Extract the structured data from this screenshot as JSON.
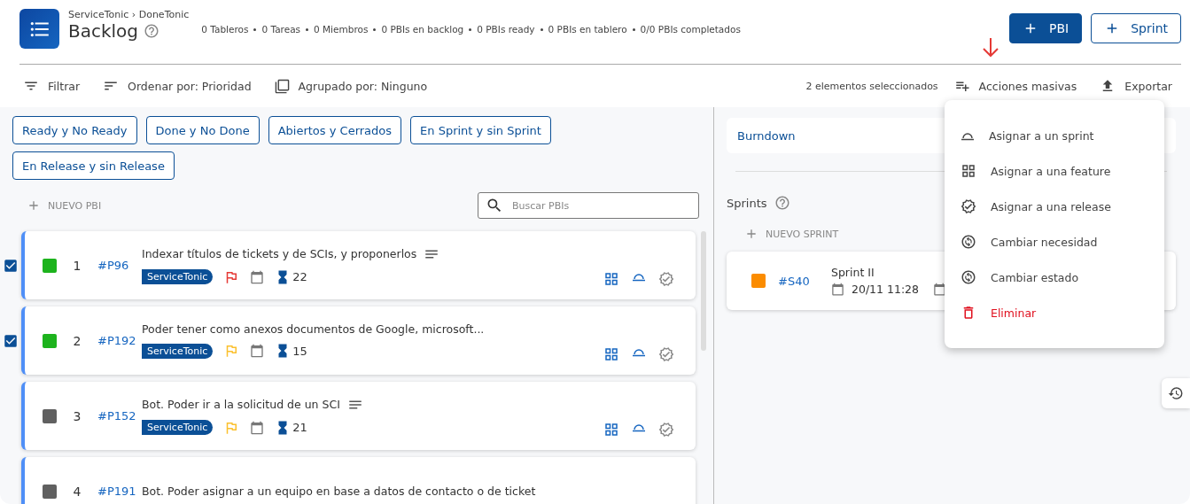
{
  "header": {
    "breadcrumb": "ServiceTonic › DoneTonic",
    "title": "Backlog",
    "stats": [
      "0 Tableros",
      "0 Tareas",
      "0 Miembros",
      "0 PBIs en backlog",
      "0 PBIs ready",
      "0 PBIs en tablero",
      "0/0 PBIs completados"
    ],
    "buttons": [
      {
        "label": "PBI",
        "kind": "primary"
      },
      {
        "label": "Sprint",
        "kind": "outline"
      }
    ]
  },
  "toolbar": {
    "filter": "Filtrar",
    "sort": "Ordenar por: Prioridad",
    "group": "Agrupado por: Ninguno",
    "selection": "2 elementos seleccionados",
    "bulk": "Acciones masivas",
    "export": "Exportar"
  },
  "annotation": {
    "kind": "arrow",
    "color": "#e53935"
  },
  "filters": [
    "Ready y No Ready",
    "Done y No Done",
    "Abiertos y Cerrados",
    "En Sprint y sin Sprint",
    "En Release y sin Release"
  ],
  "new_pbi": "NUEVO PBI",
  "search": {
    "placeholder": "Buscar PBIs"
  },
  "pbis": [
    {
      "checked": true,
      "color": "#1db31d",
      "number": "1",
      "id": "#P96",
      "title": "Indexar títulos de tickets y de SCIs, y proponerlos",
      "notes": true,
      "tag": "ServiceTonic",
      "flag": {
        "color": "#e53935"
      },
      "estimate": "22"
    },
    {
      "checked": true,
      "color": "#1db31d",
      "number": "2",
      "id": "#P192",
      "title": "Poder tener como anexos documentos de Google, microsoft...",
      "notes": false,
      "tag": "ServiceTonic",
      "flag": {
        "color": "#fbc02d"
      },
      "estimate": "15"
    },
    {
      "checked": false,
      "color": "#606060",
      "number": "3",
      "id": "#P152",
      "title": "Bot. Poder ir a la solicitud de un SCI",
      "notes": true,
      "tag": "ServiceTonic",
      "flag": {
        "color": "#fbc02d"
      },
      "estimate": "21"
    },
    {
      "checked": false,
      "color": "#606060",
      "number": "4",
      "id": "#P191",
      "title": "Bot. Poder asignar a un equipo en base a datos de contacto o de ticket",
      "notes": false
    }
  ],
  "burndown": "Burndown",
  "sprints": {
    "title": "Sprints",
    "new": "NUEVO SPRINT",
    "items": [
      {
        "color": "#fb8c00",
        "id": "#S40",
        "name": "Sprint II",
        "start": "20/11 11:28"
      }
    ]
  },
  "menu": [
    {
      "kind": "sprint",
      "label": "Asignar a un sprint"
    },
    {
      "kind": "feature",
      "label": "Asignar a una feature"
    },
    {
      "kind": "release",
      "label": "Asignar a una release"
    },
    {
      "kind": "change",
      "label": "Cambiar necesidad"
    },
    {
      "kind": "change",
      "label": "Cambiar estado"
    },
    {
      "kind": "delete",
      "label": "Eliminar"
    }
  ]
}
